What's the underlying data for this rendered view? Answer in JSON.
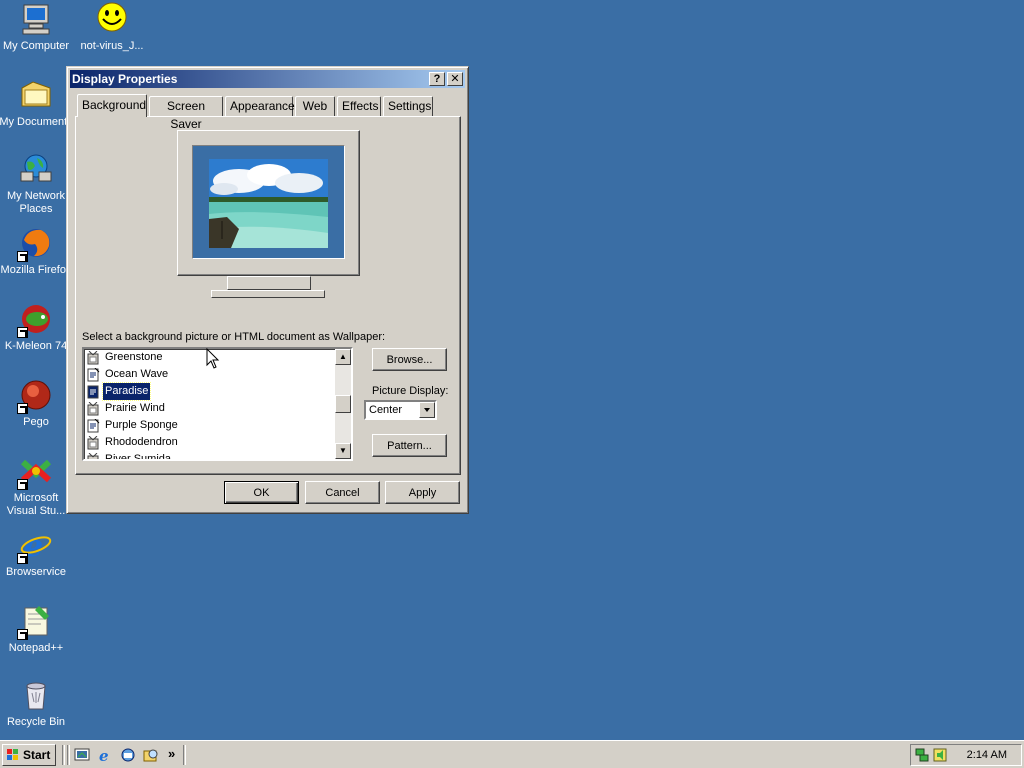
{
  "desktop": {
    "icons": [
      {
        "label": "My Computer",
        "icon": "my-computer-icon"
      },
      {
        "label": "not-virus_J...",
        "icon": "smiley-icon"
      },
      {
        "label": "My Documents",
        "icon": "folder-icon"
      },
      {
        "label": "My Network Places",
        "icon": "network-icon"
      },
      {
        "label": "Mozilla Firefox",
        "icon": "firefox-icon"
      },
      {
        "label": "K-Meleon 74",
        "icon": "kmeleon-icon"
      },
      {
        "label": "Pego",
        "icon": "pego-icon"
      },
      {
        "label": "Microsoft Visual Stu...",
        "icon": "visual-studio-icon"
      },
      {
        "label": "Browservice",
        "icon": "ie-icon"
      },
      {
        "label": "Notepad++",
        "icon": "notepadpp-icon"
      },
      {
        "label": "Recycle Bin",
        "icon": "recycle-bin-icon"
      }
    ]
  },
  "window": {
    "title": "Display Properties",
    "help_label": "?",
    "close_label": "✕",
    "tabs": [
      "Background",
      "Screen Saver",
      "Appearance",
      "Web",
      "Effects",
      "Settings"
    ],
    "active_tab": "Background",
    "wallpaper_prompt": "Select a background picture or HTML document as Wallpaper:",
    "wallpapers": [
      {
        "name": "Greenstone",
        "type": "bitmap"
      },
      {
        "name": "Ocean Wave",
        "type": "html"
      },
      {
        "name": "Paradise",
        "type": "html",
        "selected": true
      },
      {
        "name": "Prairie Wind",
        "type": "bitmap"
      },
      {
        "name": "Purple Sponge",
        "type": "html"
      },
      {
        "name": "Rhododendron",
        "type": "bitmap"
      },
      {
        "name": "River Sumida",
        "type": "bitmap"
      }
    ],
    "browse_label": "Browse...",
    "picture_display_label": "Picture Display:",
    "picture_display_value": "Center",
    "pattern_label": "Pattern...",
    "ok_label": "OK",
    "cancel_label": "Cancel",
    "apply_label": "Apply"
  },
  "taskbar": {
    "start_label": "Start",
    "chevron": "»",
    "clock": "2:14 AM",
    "quicklaunch": [
      "show-desktop-icon",
      "ie-icon",
      "outlook-icon",
      "explorer-icon"
    ]
  },
  "colors": {
    "desktop": "#3a6ea5",
    "face": "#d4d0c8",
    "title_start": "#0a246a",
    "title_end": "#a6caf0",
    "selection": "#0a246a"
  }
}
